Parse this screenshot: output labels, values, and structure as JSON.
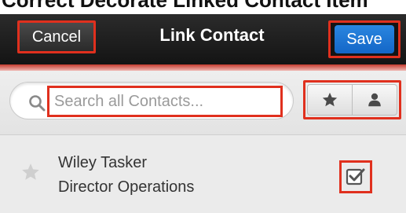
{
  "header": {
    "cancel_label": "Cancel",
    "title": "Link Contact",
    "save_label": "Save"
  },
  "search": {
    "placeholder": "Search all Contacts..."
  },
  "filters": [
    {
      "icon": "star-icon"
    },
    {
      "icon": "person-icon"
    }
  ],
  "contacts": [
    {
      "name": "Wiley Tasker",
      "title": "Director Operations",
      "favorite": false,
      "selected": true
    }
  ],
  "colors": {
    "navbar": "#1c1c1c",
    "save_blue": "#1a73d0",
    "highlight_red": "#e0301e",
    "accent_red": "#c43a2e",
    "row_bg": "#ebebeb"
  }
}
